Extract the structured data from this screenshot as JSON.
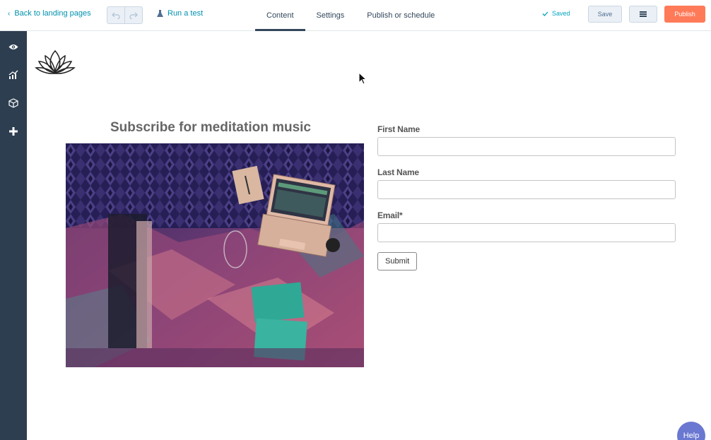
{
  "topbar": {
    "back_label": "Back to landing pages",
    "run_test_label": "Run a test",
    "tabs": [
      {
        "label": "Content",
        "active": true
      },
      {
        "label": "Settings",
        "active": false
      },
      {
        "label": "Publish or schedule",
        "active": false
      }
    ],
    "saved_label": "Saved",
    "save_label": "Save",
    "publish_label": "Publish"
  },
  "sidebar": {
    "icons": [
      "eye-icon",
      "analytics-icon",
      "cube-icon",
      "plus-icon"
    ]
  },
  "page": {
    "headline": "Subscribe for meditation music",
    "form": {
      "fields": [
        {
          "label": "First Name",
          "value": ""
        },
        {
          "label": "Last Name",
          "value": ""
        },
        {
          "label": "Email*",
          "value": ""
        }
      ],
      "submit_label": "Submit"
    }
  },
  "help_label": "Help",
  "colors": {
    "accent": "#0091ae",
    "publish": "#ff7a59",
    "sidebar": "#2d3e50",
    "help": "#6a78d1"
  }
}
